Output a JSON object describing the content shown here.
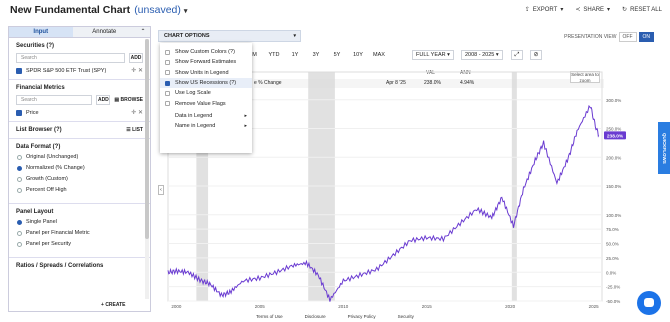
{
  "header": {
    "title": "New Fundamental Chart",
    "unsaved": "(unsaved)",
    "actions": [
      "EXPORT",
      "SHARE",
      "RESET ALL"
    ]
  },
  "sidebar": {
    "tabs": [
      "Input",
      "Annotate"
    ],
    "securities": {
      "heading": "Securities (?)",
      "search_placeholder": "Search",
      "add": "ADD",
      "item": "SPDR S&P 500 ETF Trust (SPY)"
    },
    "metrics": {
      "heading": "Financial Metrics",
      "search_placeholder": "Search",
      "add": "ADD",
      "browse": "BROWSE",
      "item": "Price"
    },
    "list_browser": {
      "heading": "List Browser (?)",
      "list": "LIST"
    },
    "data_format": {
      "heading": "Data Format (?)",
      "options": [
        "Original (Unchanged)",
        "Normalized (% Change)",
        "Growth (Custom)",
        "Percent Off High"
      ],
      "selected": 1
    },
    "panel_layout": {
      "heading": "Panel Layout",
      "options": [
        "Single Panel",
        "Panel per Financial Metric",
        "Panel per Security"
      ],
      "selected": 0
    },
    "ratios": {
      "heading": "Ratios / Spreads / Correlations",
      "create": "CREATE"
    }
  },
  "chart_options": {
    "label": "CHART OPTIONS",
    "presentation_view": "PRESENTATION VIEW",
    "off": "OFF",
    "on": "ON",
    "ranges": [
      "6M",
      "YTD",
      "1Y",
      "3Y",
      "5Y",
      "10Y",
      "MAX"
    ],
    "period": "FULL YEAR",
    "years": "2008 - 2025",
    "menu": [
      {
        "label": "Show Custom Colors (?)",
        "checked": false
      },
      {
        "label": "Show Forward Estimates",
        "checked": false
      },
      {
        "label": "Show Units in Legend",
        "checked": false
      },
      {
        "label": "Show US Recessions (?)",
        "checked": true
      },
      {
        "label": "Use Log Scale",
        "checked": false
      },
      {
        "label": "Remove Value Flags",
        "checked": false
      },
      {
        "label": "Data in Legend",
        "checked": false
      },
      {
        "label": "Name in Legend",
        "checked": false
      }
    ]
  },
  "legend": {
    "col_val": "VAL",
    "col_ann": "ANN",
    "series_suffix": "e % Change",
    "date": "Apr 8 '25",
    "val": "238.0%",
    "ann": "4.94%",
    "zoom_tip": "Select area to zoom"
  },
  "chart_data": {
    "type": "line",
    "x_ticks": [
      "2000",
      "2005",
      "2010",
      "2015",
      "2020",
      "2025"
    ],
    "y_ticks": [
      "300.0%",
      "250.0%",
      "200.0%",
      "150.0%",
      "100.0%",
      "75.0%",
      "50.0%",
      "25.0%",
      "0.0%",
      "-25.0%",
      "-50.0%"
    ],
    "flag": "238.0%",
    "recessions": [
      [
        2001.2,
        2001.9
      ],
      [
        2007.9,
        2009.5
      ],
      [
        2020.1,
        2020.4
      ]
    ],
    "series": [
      {
        "values": [
          [
            1999.5,
            0
          ],
          [
            2000.0,
            2
          ],
          [
            2000.7,
            0
          ],
          [
            2001.5,
            -15
          ],
          [
            2002.0,
            -20
          ],
          [
            2002.7,
            -40
          ],
          [
            2003.2,
            -35
          ],
          [
            2004.0,
            -15
          ],
          [
            2005.0,
            -10
          ],
          [
            2006.0,
            0
          ],
          [
            2007.0,
            12
          ],
          [
            2007.8,
            16
          ],
          [
            2008.5,
            -5
          ],
          [
            2009.2,
            -48
          ],
          [
            2010.0,
            -15
          ],
          [
            2011.0,
            -5
          ],
          [
            2012.0,
            5
          ],
          [
            2013.0,
            30
          ],
          [
            2014.0,
            55
          ],
          [
            2015.0,
            60
          ],
          [
            2016.0,
            58
          ],
          [
            2017.0,
            85
          ],
          [
            2018.0,
            110
          ],
          [
            2018.9,
            95
          ],
          [
            2019.5,
            130
          ],
          [
            2020.2,
            80
          ],
          [
            2020.8,
            145
          ],
          [
            2021.5,
            195
          ],
          [
            2022.0,
            225
          ],
          [
            2022.8,
            155
          ],
          [
            2023.5,
            200
          ],
          [
            2024.0,
            245
          ],
          [
            2024.8,
            290
          ],
          [
            2025.1,
            255
          ],
          [
            2025.3,
            238
          ]
        ]
      }
    ],
    "ylim": [
      -50,
      310
    ]
  },
  "footer": [
    "Terms of Use",
    "Disclosure",
    "Privacy Policy",
    "Security"
  ],
  "quickflows": "QUICKFLOWS",
  "colors": {
    "accent": "#2a5db0",
    "line": "#6a3bd1",
    "recession": "#d9d9d9"
  }
}
